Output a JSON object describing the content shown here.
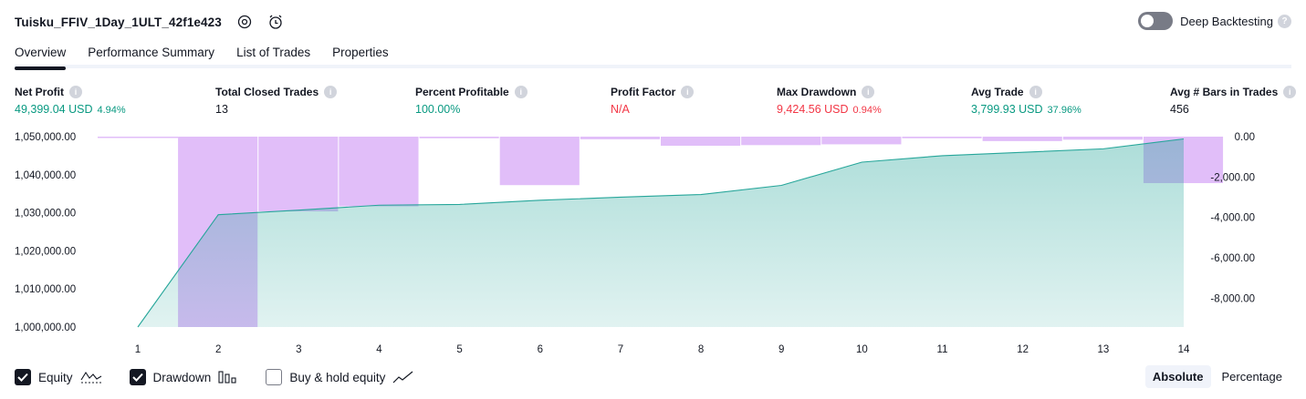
{
  "header": {
    "title": "Tuisku_FFIV_1Day_1ULT_42f1e423",
    "deep_backtesting_label": "Deep Backtesting"
  },
  "tabs": [
    {
      "label": "Overview",
      "active": true
    },
    {
      "label": "Performance Summary",
      "active": false
    },
    {
      "label": "List of Trades",
      "active": false
    },
    {
      "label": "Properties",
      "active": false
    }
  ],
  "metrics": [
    {
      "label": "Net Profit",
      "value": "49,399.04 USD",
      "sub": "4.94%",
      "color": "green"
    },
    {
      "label": "Total Closed Trades",
      "value": "13",
      "sub": "",
      "color": "dark"
    },
    {
      "label": "Percent Profitable",
      "value": "100.00%",
      "sub": "",
      "color": "green"
    },
    {
      "label": "Profit Factor",
      "value": "N/A",
      "sub": "",
      "color": "red"
    },
    {
      "label": "Max Drawdown",
      "value": "9,424.56 USD",
      "sub": "0.94%",
      "color": "red"
    },
    {
      "label": "Avg Trade",
      "value": "3,799.93 USD",
      "sub": "37.96%",
      "color": "green"
    },
    {
      "label": "Avg # Bars in Trades",
      "value": "456",
      "sub": "",
      "color": "dark"
    }
  ],
  "chart_data": {
    "type": "line",
    "x": [
      1,
      2,
      3,
      4,
      5,
      6,
      7,
      8,
      9,
      10,
      11,
      12,
      13,
      14
    ],
    "series": [
      {
        "name": "Equity",
        "axis": "left",
        "values": [
          1000000,
          1029500,
          1030700,
          1032000,
          1032200,
          1033300,
          1034100,
          1034800,
          1037200,
          1043300,
          1045000,
          1045900,
          1046800,
          1049399.04
        ]
      },
      {
        "name": "Drawdown",
        "axis": "right",
        "type": "bar",
        "values": [
          -20,
          -9424.56,
          -3700,
          -3450,
          -80,
          -2400,
          -130,
          -450,
          -420,
          -380,
          -80,
          -220,
          -150,
          -2300
        ]
      }
    ],
    "left_axis": {
      "ticks": [
        "1,050,000.00",
        "1,040,000.00",
        "1,030,000.00",
        "1,020,000.00",
        "1,010,000.00",
        "1,000,000.00"
      ],
      "range": [
        1000000,
        1050000
      ]
    },
    "right_axis": {
      "ticks": [
        "0.00",
        "-2,000.00",
        "-4,000.00",
        "-6,000.00",
        "-8,000.00"
      ],
      "range": [
        -9424.56,
        0
      ]
    },
    "equity_color": "#26a69a",
    "drawdown_color": "#e1bef9",
    "grid": false
  },
  "footer": {
    "legend": [
      {
        "label": "Equity",
        "checked": true,
        "icon": "equity-icon"
      },
      {
        "label": "Drawdown",
        "checked": true,
        "icon": "drawdown-icon"
      },
      {
        "label": "Buy & hold equity",
        "checked": false,
        "icon": "buy-hold-icon"
      }
    ],
    "modes": [
      {
        "label": "Absolute",
        "active": true
      },
      {
        "label": "Percentage",
        "active": false
      }
    ]
  }
}
